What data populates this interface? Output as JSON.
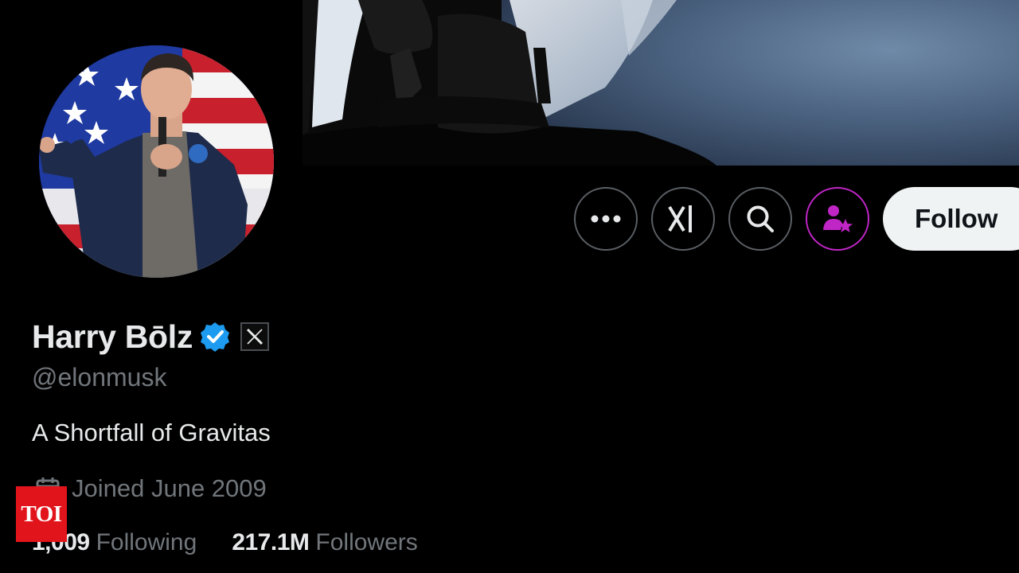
{
  "profile": {
    "display_name": "Harry Bōlz",
    "handle": "@elonmusk",
    "bio": "A Shortfall of Gravitas",
    "joined": "Joined June 2009",
    "following_count": "1,009",
    "following_label": "Following",
    "followers_count": "217.1M",
    "followers_label": "Followers"
  },
  "actions": {
    "more_icon": "more-horizontal-icon",
    "grok_icon": "grok-icon",
    "search_icon": "search-icon",
    "subscribe_icon": "subscribe-person-star-icon",
    "follow_label": "Follow"
  },
  "badges": {
    "verified_icon": "verified-checkmark-icon",
    "affiliate_icon": "x-logo-icon"
  },
  "watermark": {
    "text": "TOI"
  },
  "colors": {
    "background": "#000000",
    "primary_text": "#e7e9ea",
    "secondary_text": "#71767b",
    "verified_blue": "#1d9bf0",
    "subscribe_accent": "#c026c6",
    "follow_button_bg": "#eff3f4",
    "watermark_red": "#e2141b"
  }
}
